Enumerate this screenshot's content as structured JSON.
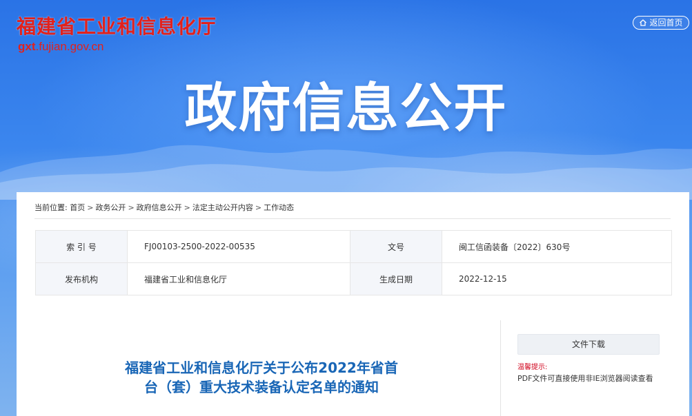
{
  "header": {
    "logo_text": "福建省工业和信息化厅",
    "logo_url_bold": "gxt",
    "logo_url_rest": ".fujian.gov.cn",
    "home_button": "返回首页",
    "banner_title": "政府信息公开"
  },
  "breadcrumb": {
    "prefix": "当前位置:",
    "items": [
      "首页",
      "政务公开",
      "政府信息公开",
      "法定主动公开内容",
      "工作动态"
    ],
    "separator": ">"
  },
  "info": {
    "index_label": "索 引 号",
    "index_value": "FJ00103-2500-2022-00535",
    "doc_no_label": "文号",
    "doc_no_value": "闽工信函装备〔2022〕630号",
    "issuer_label": "发布机构",
    "issuer_value": "福建省工业和信息化厅",
    "date_label": "生成日期",
    "date_value": "2022-12-15"
  },
  "article": {
    "title_line1": "福建省工业和信息化厅关于公布2022年省首",
    "title_line2": "台（套）重大技术装备认定名单的通知"
  },
  "sidebar": {
    "download_label": "文件下载",
    "tip_label": "温馨提示:",
    "tip_text": "PDF文件可直接使用非IE浏览器阅读查看"
  },
  "colors": {
    "logo_red": "#e2211c",
    "banner_blue": "#2f78e0",
    "title_blue": "#1966b6",
    "tip_red": "#d0021b"
  }
}
